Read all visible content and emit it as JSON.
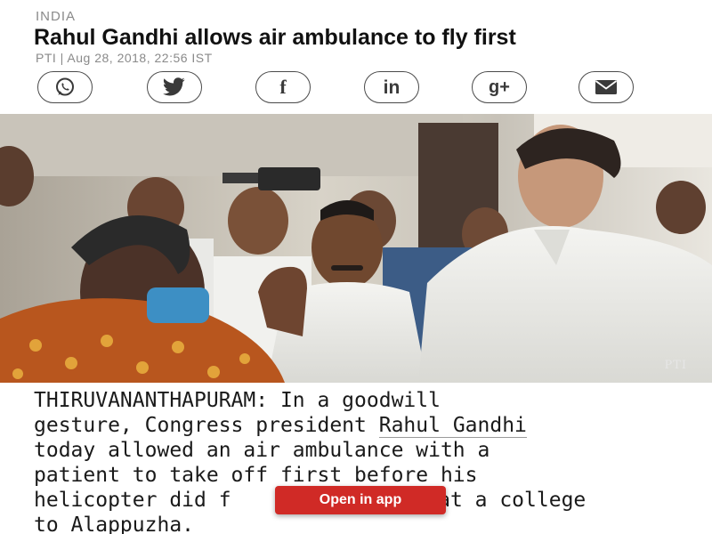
{
  "article": {
    "section": "INDIA",
    "headline": "Rahul Gandhi allows air ambulance to fly first",
    "byline": "PTI | Aug 28, 2018, 22:56 IST"
  },
  "share": {
    "buttons": [
      {
        "name": "whatsapp",
        "icon": "whatsapp-icon"
      },
      {
        "name": "twitter",
        "icon": "twitter-icon"
      },
      {
        "name": "facebook",
        "icon": "facebook-icon",
        "label": "f"
      },
      {
        "name": "linkedin",
        "icon": "linkedin-icon",
        "label": "in"
      },
      {
        "name": "google-plus",
        "icon": "google-plus-icon",
        "label": "g+"
      },
      {
        "name": "email",
        "icon": "email-icon"
      }
    ]
  },
  "photo": {
    "credit": "PTI"
  },
  "body": {
    "line1": "THIRUVANANTHAPURAM: In a goodwill",
    "line2_pre": "gesture, Congress president ",
    "line2_link": "Rahul Gandhi",
    "line3": "today allowed an air ambulance with a",
    "line4": "patient to take off first before his",
    "line5_pre": "helicopter did f",
    "line5_post": "ad at a college",
    "line6": "to Alappuzha."
  },
  "cta": {
    "open_in_app": "Open in app"
  },
  "colors": {
    "accent": "#d02a26",
    "muted_text": "#8a8a8a",
    "icon_stroke": "#4a4a4a"
  }
}
